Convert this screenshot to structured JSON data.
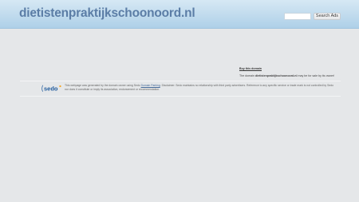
{
  "header": {
    "domain_title": "dietistenpraktijkschoonoord.nl",
    "search_placeholder": "",
    "search_button_label": "Search Ads"
  },
  "sale": {
    "buy_link_label": "Buy this domain",
    "line_prefix": "The domain ",
    "domain": "dietistenpraktijkschoonoord.nl",
    "line_suffix": " may be for sale by its owner!"
  },
  "footer": {
    "logo_text": "sedo",
    "disclaimer_before_link": "This webpage was generated by the domain owner using Sedo ",
    "disclaimer_link": "Domain Parking",
    "disclaimer_after_link": ". Disclaimer: Sedo maintains no relationship with third party advertisers. Reference to any specific service or trade mark is not controlled by Sedo nor does it constitute or imply its association, endorsement or recommendation."
  },
  "colors": {
    "header_top": "#d6e8f4",
    "header_bottom": "#aed0e8",
    "title": "#5b7da6",
    "page_background": "#e5e7e9",
    "sedo_blue": "#1f5a9c",
    "sedo_orange": "#f5a623"
  }
}
